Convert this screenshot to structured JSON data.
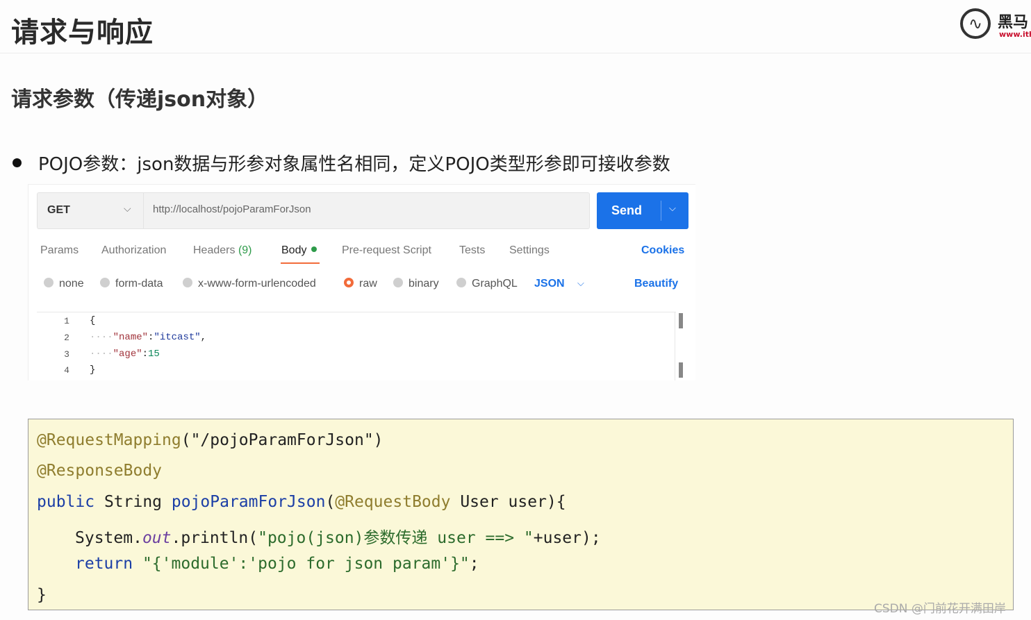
{
  "slide": {
    "title": "请求与响应",
    "subtitle": "请求参数（传递json对象）",
    "bullet": "POJO参数：json数据与形参对象属性名相同，定义POJO类型形参即可接收参数"
  },
  "logo": {
    "brand": "黑马",
    "url": "www.ith"
  },
  "postman": {
    "method": "GET",
    "url": "http://localhost/pojoParamForJson",
    "send_label": "Send",
    "tabs": [
      {
        "label": "Params",
        "count": ""
      },
      {
        "label": "Authorization",
        "count": ""
      },
      {
        "label": "Headers",
        "count": "(9)"
      },
      {
        "label": "Body",
        "count": ""
      },
      {
        "label": "Pre-request Script",
        "count": ""
      },
      {
        "label": "Tests",
        "count": ""
      },
      {
        "label": "Settings",
        "count": ""
      }
    ],
    "active_tab": "Body",
    "cookies_label": "Cookies",
    "body_types": [
      "none",
      "form-data",
      "x-www-form-urlencoded",
      "raw",
      "binary",
      "GraphQL"
    ],
    "selected_body_type": "raw",
    "format": "JSON",
    "beautify_label": "Beautify",
    "line_numbers": [
      "1",
      "2",
      "3",
      "4"
    ],
    "body_json": {
      "open": "{",
      "name_key": "\"name\"",
      "name_value": "\"itcast\"",
      "age_key": "\"age\"",
      "age_value": "15",
      "close": "}"
    },
    "colors": {
      "send": "#1b72e8",
      "active_tab": "#f26b3a",
      "ok_dot": "#2e9b4a"
    }
  },
  "code": {
    "line1_ann": "@RequestMapping",
    "line1_rest": "(\"/pojoParamForJson\")",
    "line2_ann": "@ResponseBody",
    "line3_kw": "public",
    "line3_type": " String ",
    "line3_fn": "pojoParamForJson",
    "line3_open": "(",
    "line3_ann": "@RequestBody",
    "line3_rest": " User user){",
    "line4_a": "System.",
    "line4_out": "out",
    "line4_b": ".println(",
    "line4_str": "\"pojo(json)参数传递 user ==> \"",
    "line4_c": "+user);",
    "line5_kw": "return",
    "line5_sp": " ",
    "line5_str": "\"{'module':'pojo for json param'}\"",
    "line5_end": ";",
    "line6": "}"
  },
  "watermark": "CSDN @门前花开满田岸"
}
